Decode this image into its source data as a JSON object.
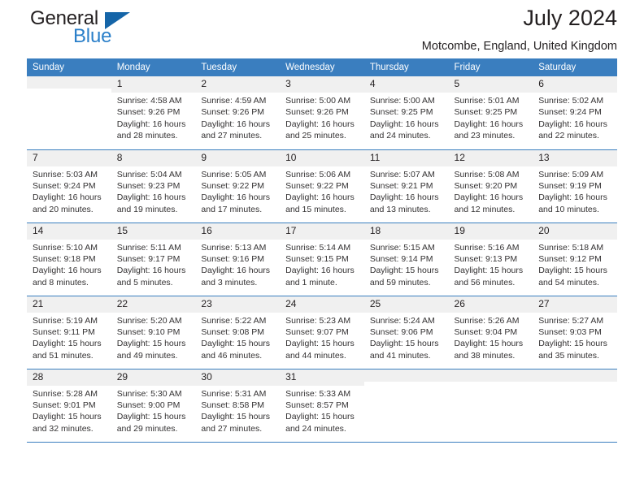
{
  "brand": {
    "line1": "General",
    "line2": "Blue",
    "icon": "triangle-logo"
  },
  "header": {
    "title": "July 2024",
    "subtitle": "Motcombe, England, United Kingdom"
  },
  "colors": {
    "header_blue": "#3a7ebf",
    "brand_blue": "#2a7fc9",
    "logo_blue": "#1565a8",
    "daynum_band": "#f0f0f0",
    "text": "#231f20"
  },
  "weekdays": [
    "Sunday",
    "Monday",
    "Tuesday",
    "Wednesday",
    "Thursday",
    "Friday",
    "Saturday"
  ],
  "weeks": [
    [
      {
        "day": "",
        "sunrise": "",
        "sunset": "",
        "daylight": ""
      },
      {
        "day": "1",
        "sunrise": "Sunrise: 4:58 AM",
        "sunset": "Sunset: 9:26 PM",
        "daylight": "Daylight: 16 hours and 28 minutes."
      },
      {
        "day": "2",
        "sunrise": "Sunrise: 4:59 AM",
        "sunset": "Sunset: 9:26 PM",
        "daylight": "Daylight: 16 hours and 27 minutes."
      },
      {
        "day": "3",
        "sunrise": "Sunrise: 5:00 AM",
        "sunset": "Sunset: 9:26 PM",
        "daylight": "Daylight: 16 hours and 25 minutes."
      },
      {
        "day": "4",
        "sunrise": "Sunrise: 5:00 AM",
        "sunset": "Sunset: 9:25 PM",
        "daylight": "Daylight: 16 hours and 24 minutes."
      },
      {
        "day": "5",
        "sunrise": "Sunrise: 5:01 AM",
        "sunset": "Sunset: 9:25 PM",
        "daylight": "Daylight: 16 hours and 23 minutes."
      },
      {
        "day": "6",
        "sunrise": "Sunrise: 5:02 AM",
        "sunset": "Sunset: 9:24 PM",
        "daylight": "Daylight: 16 hours and 22 minutes."
      }
    ],
    [
      {
        "day": "7",
        "sunrise": "Sunrise: 5:03 AM",
        "sunset": "Sunset: 9:24 PM",
        "daylight": "Daylight: 16 hours and 20 minutes."
      },
      {
        "day": "8",
        "sunrise": "Sunrise: 5:04 AM",
        "sunset": "Sunset: 9:23 PM",
        "daylight": "Daylight: 16 hours and 19 minutes."
      },
      {
        "day": "9",
        "sunrise": "Sunrise: 5:05 AM",
        "sunset": "Sunset: 9:22 PM",
        "daylight": "Daylight: 16 hours and 17 minutes."
      },
      {
        "day": "10",
        "sunrise": "Sunrise: 5:06 AM",
        "sunset": "Sunset: 9:22 PM",
        "daylight": "Daylight: 16 hours and 15 minutes."
      },
      {
        "day": "11",
        "sunrise": "Sunrise: 5:07 AM",
        "sunset": "Sunset: 9:21 PM",
        "daylight": "Daylight: 16 hours and 13 minutes."
      },
      {
        "day": "12",
        "sunrise": "Sunrise: 5:08 AM",
        "sunset": "Sunset: 9:20 PM",
        "daylight": "Daylight: 16 hours and 12 minutes."
      },
      {
        "day": "13",
        "sunrise": "Sunrise: 5:09 AM",
        "sunset": "Sunset: 9:19 PM",
        "daylight": "Daylight: 16 hours and 10 minutes."
      }
    ],
    [
      {
        "day": "14",
        "sunrise": "Sunrise: 5:10 AM",
        "sunset": "Sunset: 9:18 PM",
        "daylight": "Daylight: 16 hours and 8 minutes."
      },
      {
        "day": "15",
        "sunrise": "Sunrise: 5:11 AM",
        "sunset": "Sunset: 9:17 PM",
        "daylight": "Daylight: 16 hours and 5 minutes."
      },
      {
        "day": "16",
        "sunrise": "Sunrise: 5:13 AM",
        "sunset": "Sunset: 9:16 PM",
        "daylight": "Daylight: 16 hours and 3 minutes."
      },
      {
        "day": "17",
        "sunrise": "Sunrise: 5:14 AM",
        "sunset": "Sunset: 9:15 PM",
        "daylight": "Daylight: 16 hours and 1 minute."
      },
      {
        "day": "18",
        "sunrise": "Sunrise: 5:15 AM",
        "sunset": "Sunset: 9:14 PM",
        "daylight": "Daylight: 15 hours and 59 minutes."
      },
      {
        "day": "19",
        "sunrise": "Sunrise: 5:16 AM",
        "sunset": "Sunset: 9:13 PM",
        "daylight": "Daylight: 15 hours and 56 minutes."
      },
      {
        "day": "20",
        "sunrise": "Sunrise: 5:18 AM",
        "sunset": "Sunset: 9:12 PM",
        "daylight": "Daylight: 15 hours and 54 minutes."
      }
    ],
    [
      {
        "day": "21",
        "sunrise": "Sunrise: 5:19 AM",
        "sunset": "Sunset: 9:11 PM",
        "daylight": "Daylight: 15 hours and 51 minutes."
      },
      {
        "day": "22",
        "sunrise": "Sunrise: 5:20 AM",
        "sunset": "Sunset: 9:10 PM",
        "daylight": "Daylight: 15 hours and 49 minutes."
      },
      {
        "day": "23",
        "sunrise": "Sunrise: 5:22 AM",
        "sunset": "Sunset: 9:08 PM",
        "daylight": "Daylight: 15 hours and 46 minutes."
      },
      {
        "day": "24",
        "sunrise": "Sunrise: 5:23 AM",
        "sunset": "Sunset: 9:07 PM",
        "daylight": "Daylight: 15 hours and 44 minutes."
      },
      {
        "day": "25",
        "sunrise": "Sunrise: 5:24 AM",
        "sunset": "Sunset: 9:06 PM",
        "daylight": "Daylight: 15 hours and 41 minutes."
      },
      {
        "day": "26",
        "sunrise": "Sunrise: 5:26 AM",
        "sunset": "Sunset: 9:04 PM",
        "daylight": "Daylight: 15 hours and 38 minutes."
      },
      {
        "day": "27",
        "sunrise": "Sunrise: 5:27 AM",
        "sunset": "Sunset: 9:03 PM",
        "daylight": "Daylight: 15 hours and 35 minutes."
      }
    ],
    [
      {
        "day": "28",
        "sunrise": "Sunrise: 5:28 AM",
        "sunset": "Sunset: 9:01 PM",
        "daylight": "Daylight: 15 hours and 32 minutes."
      },
      {
        "day": "29",
        "sunrise": "Sunrise: 5:30 AM",
        "sunset": "Sunset: 9:00 PM",
        "daylight": "Daylight: 15 hours and 29 minutes."
      },
      {
        "day": "30",
        "sunrise": "Sunrise: 5:31 AM",
        "sunset": "Sunset: 8:58 PM",
        "daylight": "Daylight: 15 hours and 27 minutes."
      },
      {
        "day": "31",
        "sunrise": "Sunrise: 5:33 AM",
        "sunset": "Sunset: 8:57 PM",
        "daylight": "Daylight: 15 hours and 24 minutes."
      },
      {
        "day": "",
        "sunrise": "",
        "sunset": "",
        "daylight": ""
      },
      {
        "day": "",
        "sunrise": "",
        "sunset": "",
        "daylight": ""
      },
      {
        "day": "",
        "sunrise": "",
        "sunset": "",
        "daylight": ""
      }
    ]
  ]
}
